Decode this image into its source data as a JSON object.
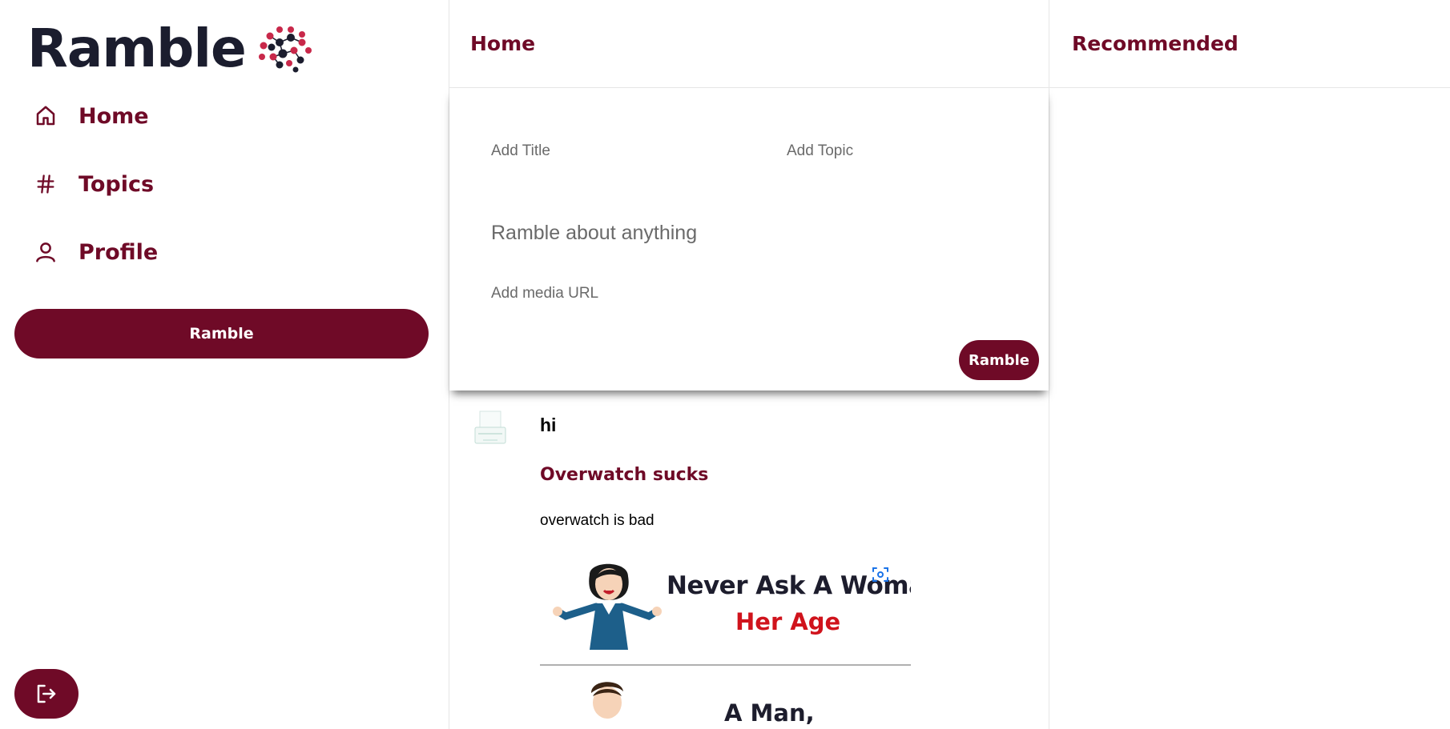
{
  "app": {
    "logo_text": "Ramble",
    "brand_color": "#6f0a27",
    "logo_text_color": "#1b1d2e"
  },
  "sidebar": {
    "items": [
      {
        "label": "Home",
        "icon": "home-icon"
      },
      {
        "label": "Topics",
        "icon": "hash-icon"
      },
      {
        "label": "Profile",
        "icon": "user-icon"
      }
    ],
    "ramble_button_label": "Ramble",
    "logout_icon": "logout-icon"
  },
  "center": {
    "title": "Home",
    "composer": {
      "title_placeholder": "Add Title",
      "topic_placeholder": "Add Topic",
      "body_placeholder": "Ramble about anything",
      "media_placeholder": "Add media URL",
      "submit_label": "Ramble"
    },
    "feed": [
      {
        "author": "hi",
        "title": "Overwatch sucks",
        "body": "overwatch is bad",
        "image": {
          "line1": "Never Ask A Woman",
          "line2": "Her Age",
          "line3": "A Man,",
          "accent_color": "#d0131c"
        }
      }
    ]
  },
  "right": {
    "title": "Recommended"
  }
}
